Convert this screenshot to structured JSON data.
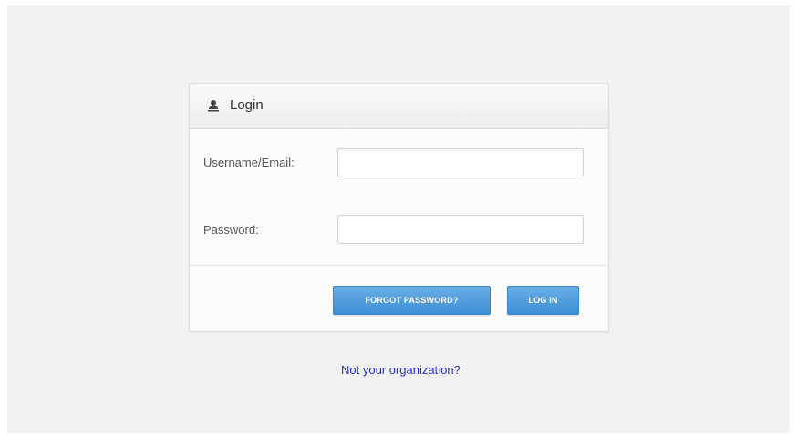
{
  "login_panel": {
    "title": "Login",
    "icon": "user-icon",
    "username_label": "Username/Email:",
    "username_value": "",
    "password_label": "Password:",
    "password_value": "",
    "forgot_button_label": "FORGOT PASSWORD?",
    "login_button_label": "LOG IN"
  },
  "footer": {
    "org_link": "Not your organization?"
  },
  "colors": {
    "button_blue": "#4a9ad9",
    "link_blue": "#2a2ac8",
    "background": "#f2f2f2"
  }
}
